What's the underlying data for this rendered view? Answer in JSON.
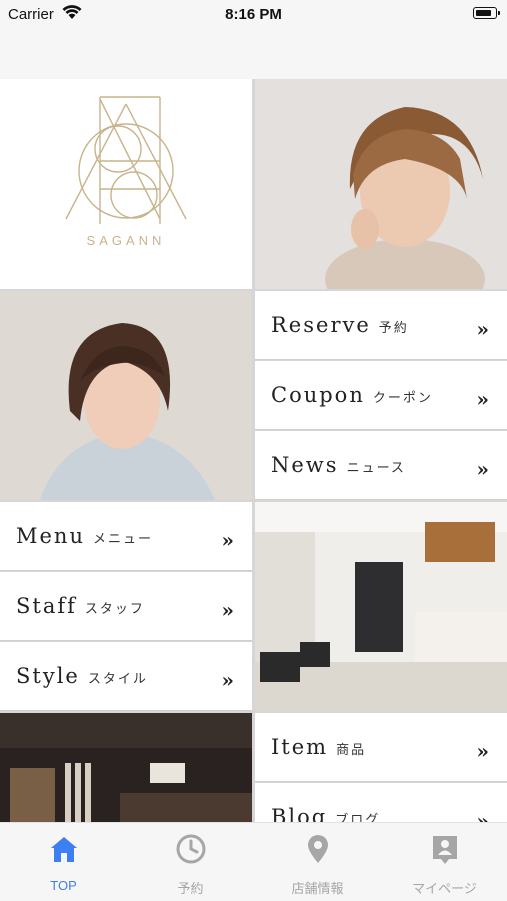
{
  "status_bar": {
    "carrier": "Carrier",
    "time": "8:16 PM"
  },
  "brand": {
    "logo_text": "SAGANN"
  },
  "menu": [
    {
      "en": "Reserve",
      "ja": "予約"
    },
    {
      "en": "Coupon",
      "ja": "クーポン"
    },
    {
      "en": "News",
      "ja": "ニュース"
    },
    {
      "en": "Menu",
      "ja": "メニュー"
    },
    {
      "en": "Staff",
      "ja": "スタッフ"
    },
    {
      "en": "Style",
      "ja": "スタイル"
    },
    {
      "en": "Item",
      "ja": "商品"
    },
    {
      "en": "Blog",
      "ja": "ブログ"
    }
  ],
  "chevron": "»",
  "tabs": [
    {
      "label": "TOP",
      "icon": "home-icon",
      "active": true
    },
    {
      "label": "予約",
      "icon": "clock-icon"
    },
    {
      "label": "店舗情報",
      "icon": "map-pin-icon"
    },
    {
      "label": "マイページ",
      "icon": "profile-icon"
    }
  ],
  "colors": {
    "accent": "#3d7ff0",
    "inactive": "#a6a6a6",
    "logo_gold": "#c8b48c"
  }
}
